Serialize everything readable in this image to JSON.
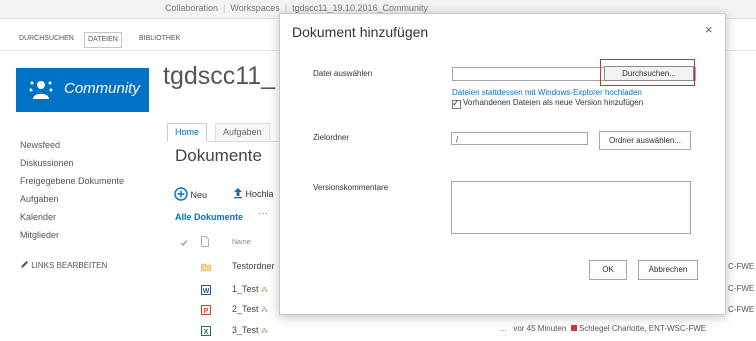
{
  "topbar": {
    "crumbs": [
      "Collaboration",
      "Workspaces",
      "tgdscc11_19.10.2016_Community"
    ]
  },
  "ribbon": {
    "tabs": [
      "DURCHSUCHEN",
      "DATEIEN",
      "BIBLIOTHEK"
    ]
  },
  "site": {
    "logo_text": "Community",
    "title": "tgdscc11_"
  },
  "nav": {
    "items": [
      "Newsfeed",
      "Diskussionen",
      "Freigegebene Dokumente",
      "Aufgaben",
      "Kalender",
      "Mitglieder"
    ],
    "edit_links": "LINKS BEARBEITEN"
  },
  "content": {
    "tabs": [
      "Home",
      "Aufgaben"
    ],
    "heading": "Dokumente",
    "new_label": "Neu",
    "upload_label": "Hochla",
    "all_docs": "Alle Dokumente",
    "more": "···",
    "col_name": "Name",
    "rows": [
      {
        "name": "Testordner",
        "type": "folder"
      },
      {
        "name": "1_Test",
        "type": "word"
      },
      {
        "name": "2_Test",
        "type": "ppt"
      },
      {
        "name": "3_Test",
        "type": "excel"
      }
    ],
    "right_edge": [
      "C-FWE",
      "C-FWE",
      "C-FWE"
    ],
    "bottom_meta": {
      "dots": "...",
      "time": "vor 45 Minuten",
      "author": "Schlegel Charlotte, ENT-WSC-FWE"
    }
  },
  "dialog": {
    "title": "Dokument hinzufügen",
    "close": "×",
    "file_label": "Datei auswählen",
    "browse": "Durchsuchen...",
    "explorer_link": "Dateien stattdessen mit Windows-Explorer hochladen",
    "version_label": "Vorhandenen Dateien als neue Version hinzufügen",
    "version_checked": true,
    "folder_label": "Zielordner",
    "folder_value": "/",
    "folder_button": "Ordner auswählen...",
    "comments_label": "Versionskommentare",
    "ok": "OK",
    "cancel": "Abbrechen"
  },
  "colors": {
    "brand": "#0072c6",
    "highlight": "#d62b2b",
    "status_square": "#c23b3b",
    "new_marker": "#6aa84f"
  },
  "icons": {
    "close": "close-icon",
    "new": "plus-circle-icon",
    "upload": "upload-arrow-icon",
    "folder": "folder-icon",
    "word": "word-doc-icon",
    "ppt": "powerpoint-doc-icon",
    "excel": "excel-doc-icon"
  }
}
